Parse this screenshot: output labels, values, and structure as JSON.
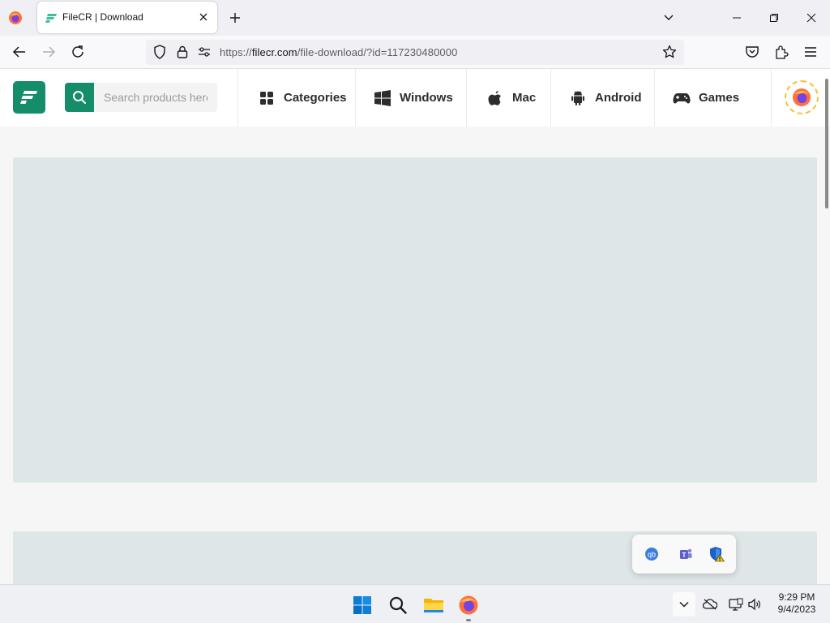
{
  "browser": {
    "tab": {
      "title": "FileCR | Download"
    },
    "url": {
      "prefix": "https://",
      "host": "filecr.com",
      "path": "/file-download/?id=117230480000"
    }
  },
  "site": {
    "search": {
      "placeholder": "Search products here"
    },
    "menu": [
      {
        "label": "Categories",
        "icon": "grid-icon"
      },
      {
        "label": "Windows",
        "icon": "windows-icon"
      },
      {
        "label": "Mac",
        "icon": "apple-icon"
      },
      {
        "label": "Android",
        "icon": "android-icon"
      },
      {
        "label": "Games",
        "icon": "gamepad-icon"
      }
    ],
    "brand_color": "#158c6a"
  },
  "taskbar": {
    "clock": {
      "time": "9:29 PM",
      "date": "9/4/2023"
    }
  }
}
